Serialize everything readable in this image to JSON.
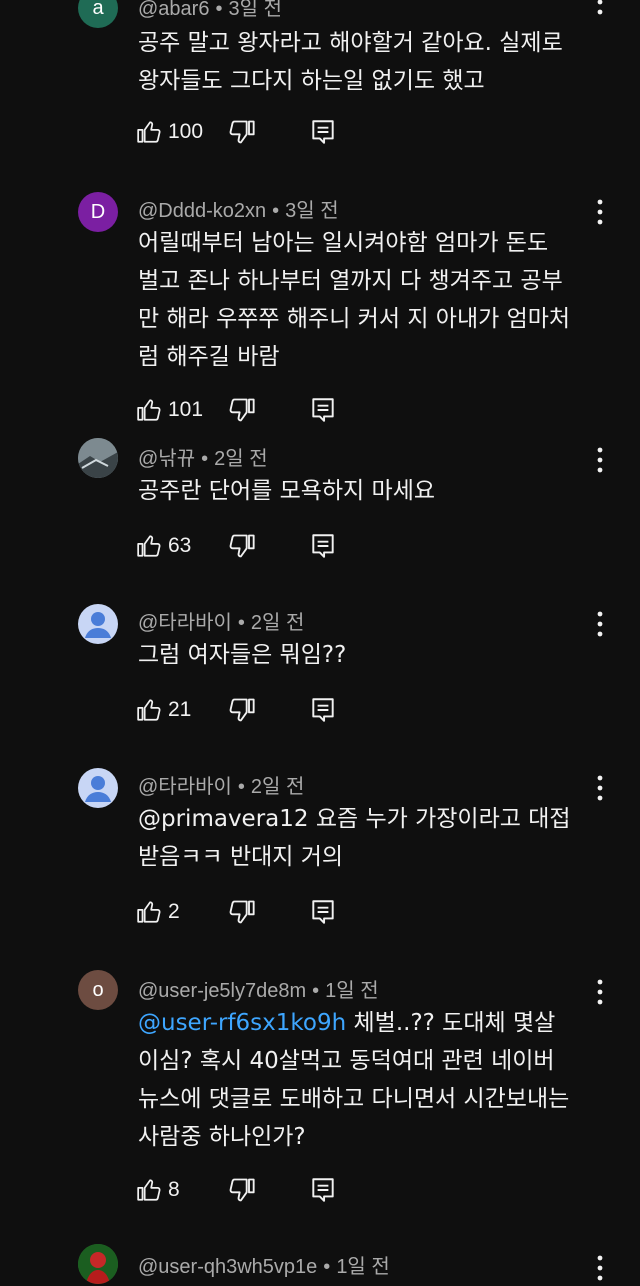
{
  "comments": [
    {
      "avatar_letter": "a",
      "avatar_color": "#1f6b55",
      "author": "@abar6",
      "time": "3일 전",
      "text": "공주 말고 왕자라고 해야할거 같아요. 실제로\n왕자들도 그다지 하는일 없기도 했고",
      "likes": "100"
    },
    {
      "avatar_letter": "D",
      "avatar_color": "#7b1fa2",
      "author": "@Dddd-ko2xn",
      "time": "3일 전",
      "text": "어릴때부터 남아는 일시켜야함 엄마가 돈도\n벌고 존나 하나부터 열까지 다 챙겨주고 공부\n만 해라 우쭈쭈 해주니 커서 지 아내가 엄마처\n럼 해주길 바람",
      "likes": "101"
    },
    {
      "avatar_letter": "",
      "avatar_color": "#6e7a80",
      "author": "@낚뀨",
      "time": "2일 전",
      "text": "공주란 단어를 모욕하지 마세요",
      "likes": "63"
    },
    {
      "avatar_letter": "",
      "avatar_color": "#c8d6f5",
      "author": "@타라바이",
      "time": "2일 전",
      "text": "그럼 여자들은 뭐임??",
      "likes": "21"
    },
    {
      "avatar_letter": "",
      "avatar_color": "#c8d6f5",
      "author": "@타라바이",
      "time": "2일 전",
      "mention": "",
      "text_prefix": "@primavera12  ",
      "text": "요즘 누가 가장이라고 대접\n받음ㅋㅋ 반대지 거의",
      "likes": "2"
    },
    {
      "avatar_letter": "o",
      "avatar_color": "#6d4c41",
      "author": "@user-je5ly7de8m",
      "time": "1일 전",
      "mention": "@user-rf6sx1ko9h",
      "text": " 체벌..?? 도대체 몇살\n이심? 혹시 40살먹고 동덕여대 관련 네이버\n뉴스에 댓글로 도배하고 다니면서 시간보내는\n사람중 하나인가?",
      "likes": "8"
    },
    {
      "avatar_letter": "",
      "avatar_color": "#2e7d32",
      "author": "@user-qh3wh5vp1e",
      "time": "1일 전"
    }
  ],
  "icons": {
    "like": "thumbs-up-icon",
    "dislike": "thumbs-down-icon",
    "reply": "reply-icon",
    "more": "more-vert-icon"
  }
}
